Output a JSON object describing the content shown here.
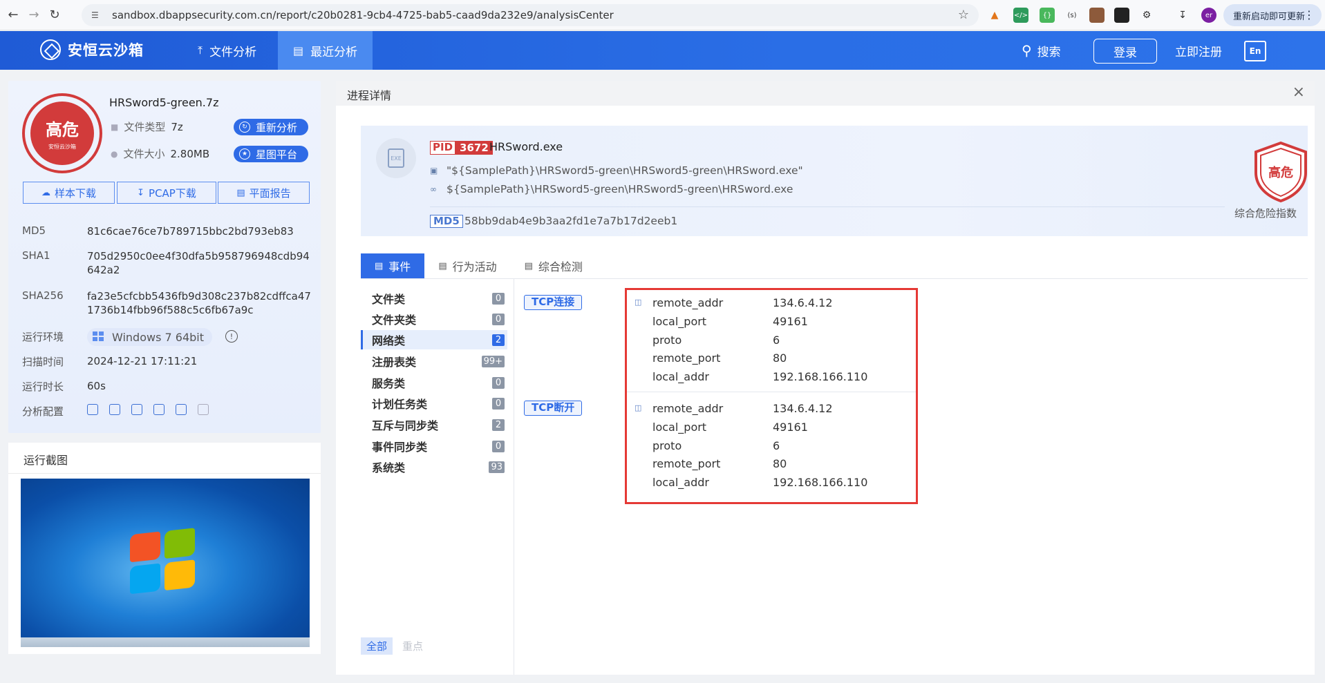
{
  "browser": {
    "url": "sandbox.dbappsecurity.com.cn/report/c20b0281-9cb4-4725-bab5-caad9da232e9/analysisCenter",
    "restart_label": "重新启动即可更新",
    "profile_initials": "er"
  },
  "header": {
    "logo": "安恒云沙箱",
    "nav": [
      {
        "label": "文件分析",
        "icon": "upload-file-icon"
      },
      {
        "label": "最近分析",
        "icon": "list-doc-icon",
        "active": true
      }
    ],
    "search_label": "搜索",
    "login_label": "登录",
    "register_label": "立即注册",
    "lang_label": "En"
  },
  "file": {
    "risk_label": "高危",
    "risk_sub": "安恒云沙箱",
    "name": "HRSword5-green.7z",
    "type_label": "文件类型",
    "type_value": "7z",
    "size_label": "文件大小",
    "size_value": "2.80MB",
    "reanalyze_label": "重新分析",
    "xingtu_label": "星图平台",
    "download_sample": "样本下载",
    "download_pcap": "PCAP下载",
    "report_label": "平面报告",
    "md5_label": "MD5",
    "md5": "81c6cae76ce7b789715bbc2bd793eb83",
    "sha1_label": "SHA1",
    "sha1": "705d2950c0ee4f30dfa5b958796948cdb94642a2",
    "sha256_label": "SHA256",
    "sha256": "fa23e5cfcbb5436fb9d308c237b82cdffca471736b14fbb96f588c5c6fb67a9c",
    "env_label": "运行环境",
    "env_value": "Windows 7 64bit",
    "scan_time_label": "扫描时间",
    "scan_time": "2024-12-21 17:11:21",
    "duration_label": "运行时长",
    "duration": "60s",
    "config_label": "分析配置"
  },
  "screenshot": {
    "title": "运行截图"
  },
  "process": {
    "panel_title": "进程详情",
    "pid_label": "PID",
    "pid": "3672",
    "name": "HRSword.exe",
    "cmdline": "\"${SamplePath}\\HRSword5-green\\HRSword5-green\\HRSword.exe\"",
    "path": "${SamplePath}\\HRSword5-green\\HRSword5-green\\HRSword.exe",
    "md5_label": "MD5",
    "md5": "58bb9dab4e9b3aa2fd1e7a7b17d2eeb1",
    "risk_label": "高危",
    "risk_caption": "综合危险指数"
  },
  "tabs": [
    {
      "label": "事件",
      "active": true
    },
    {
      "label": "行为活动"
    },
    {
      "label": "综合检测"
    }
  ],
  "categories": [
    {
      "label": "文件类",
      "count": "0"
    },
    {
      "label": "文件夹类",
      "count": "0"
    },
    {
      "label": "网络类",
      "count": "2",
      "active": true
    },
    {
      "label": "注册表类",
      "count": "99+"
    },
    {
      "label": "服务类",
      "count": "0"
    },
    {
      "label": "计划任务类",
      "count": "0"
    },
    {
      "label": "互斥与同步类",
      "count": "2"
    },
    {
      "label": "事件同步类",
      "count": "0"
    },
    {
      "label": "系统类",
      "count": "93"
    }
  ],
  "filters": {
    "all": "全部",
    "key": "重点"
  },
  "events": [
    {
      "tag": "TCP连接",
      "fields": [
        {
          "k": "remote_addr",
          "v": "134.6.4.12"
        },
        {
          "k": "local_port",
          "v": "49161"
        },
        {
          "k": "proto",
          "v": "6"
        },
        {
          "k": "remote_port",
          "v": "80"
        },
        {
          "k": "local_addr",
          "v": "192.168.166.110"
        }
      ]
    },
    {
      "tag": "TCP断开",
      "fields": [
        {
          "k": "remote_addr",
          "v": "134.6.4.12"
        },
        {
          "k": "local_port",
          "v": "49161"
        },
        {
          "k": "proto",
          "v": "6"
        },
        {
          "k": "remote_port",
          "v": "80"
        },
        {
          "k": "local_addr",
          "v": "192.168.166.110"
        }
      ]
    }
  ],
  "colors": {
    "brand": "#2f6be6",
    "danger": "#d23b3b",
    "highlight": "#e53935"
  }
}
